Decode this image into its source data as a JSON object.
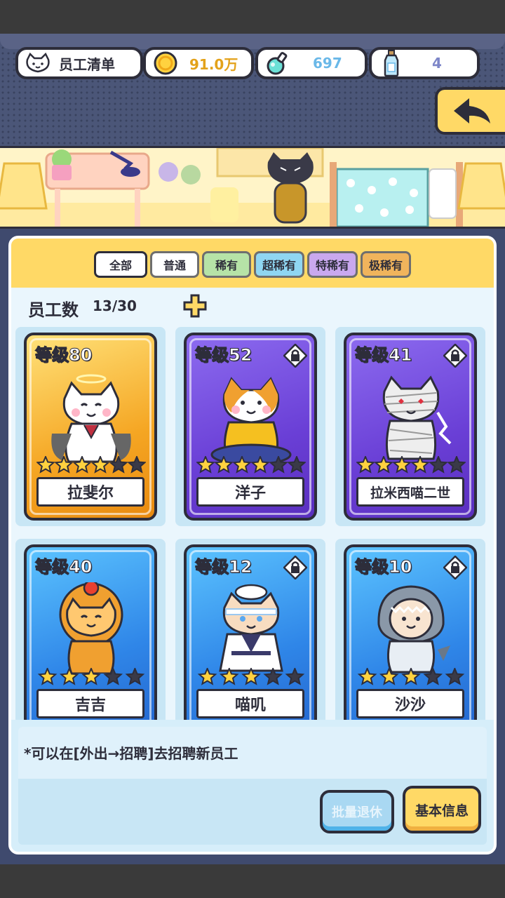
{
  "header": {
    "title": "员工清单",
    "coins": "91.0万",
    "potions": "697",
    "bottles": "4",
    "icons": {
      "title": "cat-face-icon",
      "coins": "gold-coin-icon",
      "potions": "potion-flask-icon",
      "bottles": "message-bottle-icon",
      "back": "back-arrow-icon"
    }
  },
  "filters": [
    {
      "label": "全部"
    },
    {
      "label": "普通"
    },
    {
      "label": "稀有"
    },
    {
      "label": "超稀有"
    },
    {
      "label": "特稀有"
    },
    {
      "label": "极稀有"
    }
  ],
  "staff": {
    "label": "员工数",
    "count": "13/30"
  },
  "cards": [
    {
      "level": "等级80",
      "name": "拉斐尔",
      "rarity": "gold",
      "stars": 4,
      "max_stars": 6,
      "locked": false
    },
    {
      "level": "等级52",
      "name": "洋子",
      "rarity": "purple",
      "stars": 4,
      "max_stars": 6,
      "locked": true
    },
    {
      "level": "等级41",
      "name": "拉米西喵二世",
      "rarity": "purple",
      "stars": 4,
      "max_stars": 6,
      "locked": true
    },
    {
      "level": "等级40",
      "name": "吉吉",
      "rarity": "blue",
      "stars": 3,
      "max_stars": 5,
      "locked": false
    },
    {
      "level": "等级12",
      "name": "喵叽",
      "rarity": "blue",
      "stars": 3,
      "max_stars": 5,
      "locked": true
    },
    {
      "level": "等级10",
      "name": "沙沙",
      "rarity": "blue",
      "stars": 3,
      "max_stars": 5,
      "locked": true
    }
  ],
  "tip": "*可以在[外出→招聘]去招聘新员工",
  "buttons": {
    "retire": "批量退休",
    "info": "基本信息"
  },
  "colors": {
    "gold_card": "#f5a623",
    "purple_card": "#6a3fd6",
    "blue_card": "#2f86e8",
    "panel_head": "#ffd966",
    "panel_bg": "#d6eefa"
  }
}
